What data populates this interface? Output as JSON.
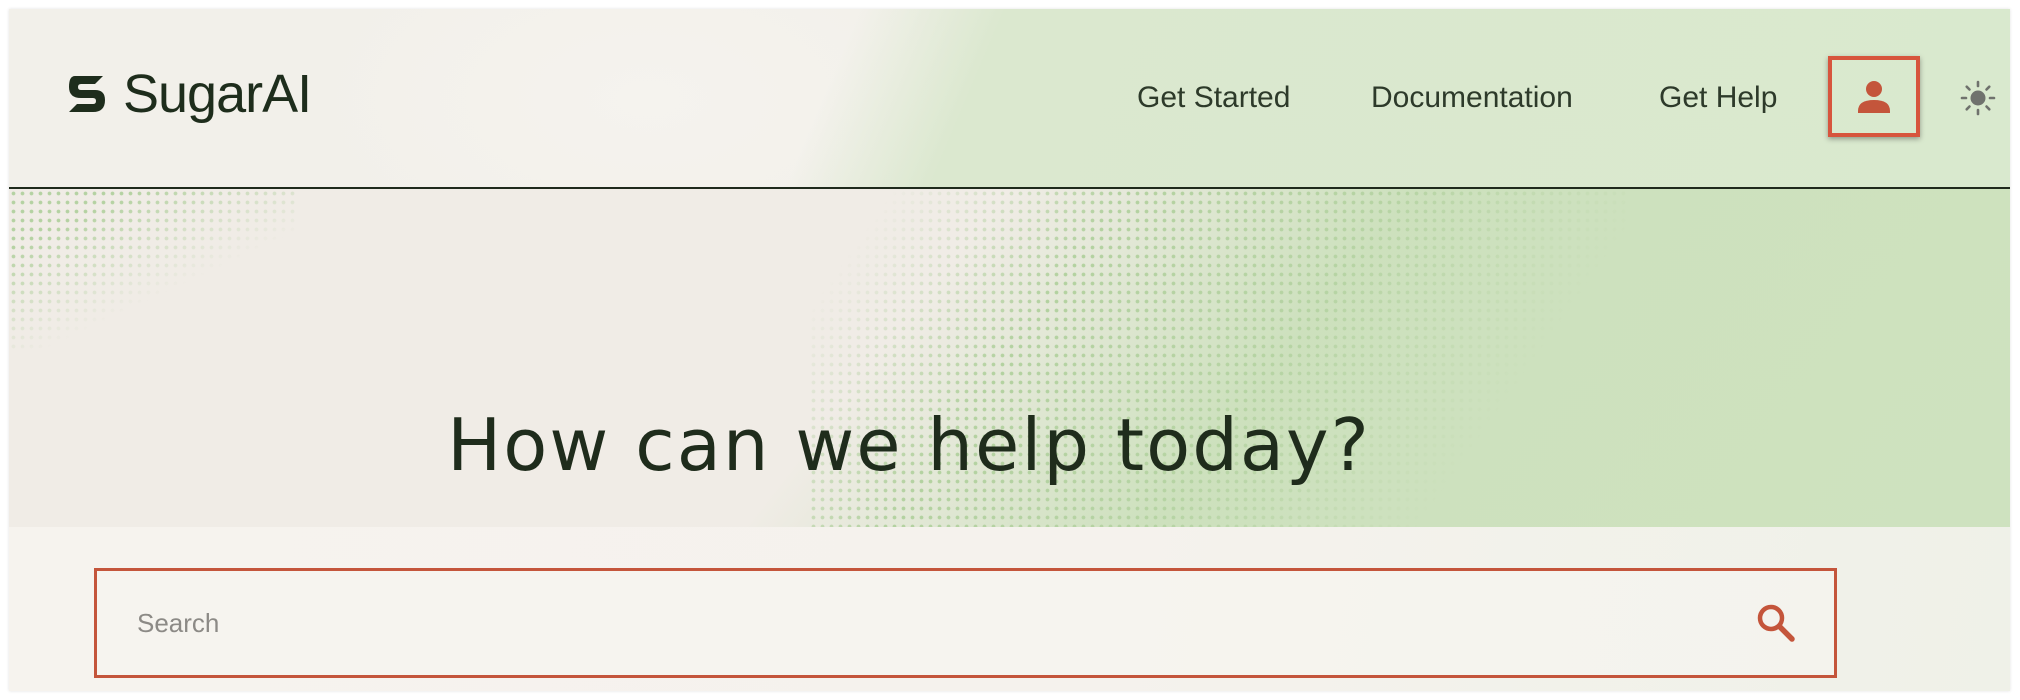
{
  "header": {
    "brand_name": "SugarAI",
    "logo_icon": "sugarai-logo-mark",
    "nav": {
      "get_started": "Get Started",
      "documentation": "Documentation",
      "get_help": "Get Help"
    },
    "user_icon": "person-icon",
    "theme_icon": "sun-icon"
  },
  "hero": {
    "title": "How can we help today?"
  },
  "search": {
    "placeholder": "Search",
    "value": "",
    "icon": "search-icon"
  },
  "colors": {
    "brand_dark": "#1e2d1c",
    "accent": "#c4553b",
    "highlight_box": "#d7553d",
    "header_green": "#d9e9ce"
  }
}
